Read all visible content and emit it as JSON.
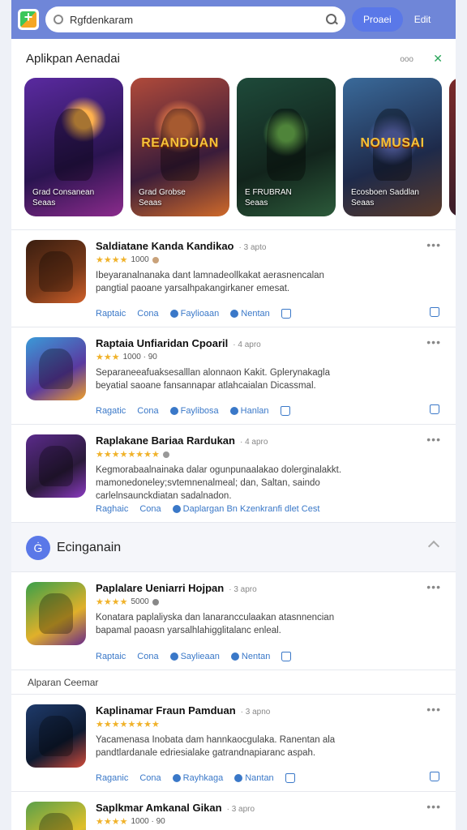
{
  "header": {
    "search_value": "Rgfdenkaram",
    "primary_button": "Proaei",
    "edit_link": "Edit"
  },
  "featured": {
    "title": "Aplikpan Aenadai",
    "more_label": "ooo",
    "close_label": "✕",
    "cards": [
      {
        "caption": "Grad Consanean\nSeaas",
        "banner": ""
      },
      {
        "caption": "Grad Grobse\nSeaas",
        "banner": "REANDUAN"
      },
      {
        "caption": "E FRUBRAN\nSeaas",
        "banner": ""
      },
      {
        "caption": "Ecosboen Saddlan\nSeaas",
        "banner": "NOMUSAI"
      },
      {
        "caption": "",
        "banner": ""
      }
    ]
  },
  "apps": [
    {
      "name": "Saldiatane Kanda Kandikao",
      "tag": "· 3 apto",
      "stars": "★★★★",
      "rating": "1000",
      "desc": "Ibeyaranalnanaka dant lamnadeollkakat aerasnencalan pangtial paoane yarsalhpakangirkaner emesat.",
      "actions": [
        "Raptaic",
        "Cona",
        "Faylioaan",
        "Nentan"
      ]
    },
    {
      "name": "Raptaia Unfiaridan Cpoaril",
      "tag": "· 4 apro",
      "stars": "★★★",
      "rating": "1000 · 90",
      "desc": "Separaneeafuaksesalllan alonnaon Kakit. Gplerynakagla beyatial saoane fansannapar atlahcaialan Dicassmal.",
      "actions": [
        "Ragatic",
        "Cona",
        "Faylibosa",
        "Hanlan"
      ]
    },
    {
      "name": "Raplakane Bariaa Rardukan",
      "tag": "· 4 apro",
      "stars": "★★★★★★★★",
      "rating": "",
      "desc": "Kegmorabaalnainaka dalar ogunpunaalakao dolerginalakkt. mamonedoneley;svtemnenalmeal; dan, Saltan, saindo carlelnsaunckdiatan sadalnadon.",
      "actions": [
        "Raghaic",
        "Cona",
        "Daplargan Bn Kzenkranfi dlet Cest"
      ]
    }
  ],
  "section": {
    "icon_label": "Ġ",
    "title": "Ecinganain"
  },
  "section_apps": [
    {
      "name": "Paplalare Ueniarri Hojpan",
      "tag": "· 3 apro",
      "stars": "★★★★",
      "rating": "5000",
      "desc": "Konatara paplaliyska dan lanarancculaakan atasnnencian bapamal paoasn yarsalhlahigglitalanc enleal.",
      "actions": [
        "Raptaic",
        "Cona",
        "Saylieaan",
        "Nentan"
      ]
    }
  ],
  "subhead": "Alparan Ceemar",
  "sub_apps": [
    {
      "name": "Kaplinamar Fraun Pamduan",
      "tag": "· 3 apno",
      "stars": "★★★★★★★★",
      "rating": "",
      "desc": "Yacamenasa Inobata dam hannkaocgulaka. Ranentan ala pandtlardanale edriesialake gatrandnapiaranc aspah.",
      "actions": [
        "Raganic",
        "Cona",
        "Rayhkaga",
        "Nantan"
      ]
    },
    {
      "name": "Saplkmar Amkanal Gikan",
      "tag": "· 3 apro",
      "stars": "★★★★",
      "rating": "1000 · 90",
      "desc": "",
      "actions": []
    }
  ]
}
